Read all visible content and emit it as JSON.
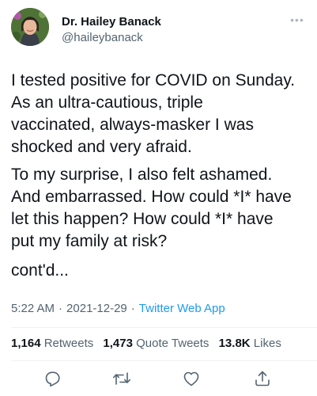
{
  "author": {
    "name": "Dr. Hailey Banack",
    "handle": "@haileybanack"
  },
  "tweet": {
    "paragraphs": [
      [
        "I tested positive for COVID on Sunday.",
        "As an ultra-cautious, triple",
        "vaccinated, always-masker I was",
        "shocked and very afraid."
      ],
      [
        "To my surprise, I also felt ashamed.",
        "And embarrassed. How could *I* have",
        "let this happen? How could *I* have",
        "put my family at risk?"
      ],
      [
        "cont'd..."
      ]
    ],
    "time": "5:22 AM",
    "date": "2021-12-29",
    "app": "Twitter Web App"
  },
  "stats": {
    "retweets_count": "1,164",
    "retweets_label": "Retweets",
    "quotes_count": "1,473",
    "quotes_label": "Quote Tweets",
    "likes_count": "13.8K",
    "likes_label": "Likes"
  },
  "actions": [
    {
      "name": "reply-icon"
    },
    {
      "name": "retweet-icon"
    },
    {
      "name": "like-icon"
    },
    {
      "name": "share-icon"
    }
  ],
  "colors": {
    "text": "#0f1419",
    "secondary": "#536471",
    "link": "#1d9bf0",
    "divider": "#eff3f4"
  }
}
